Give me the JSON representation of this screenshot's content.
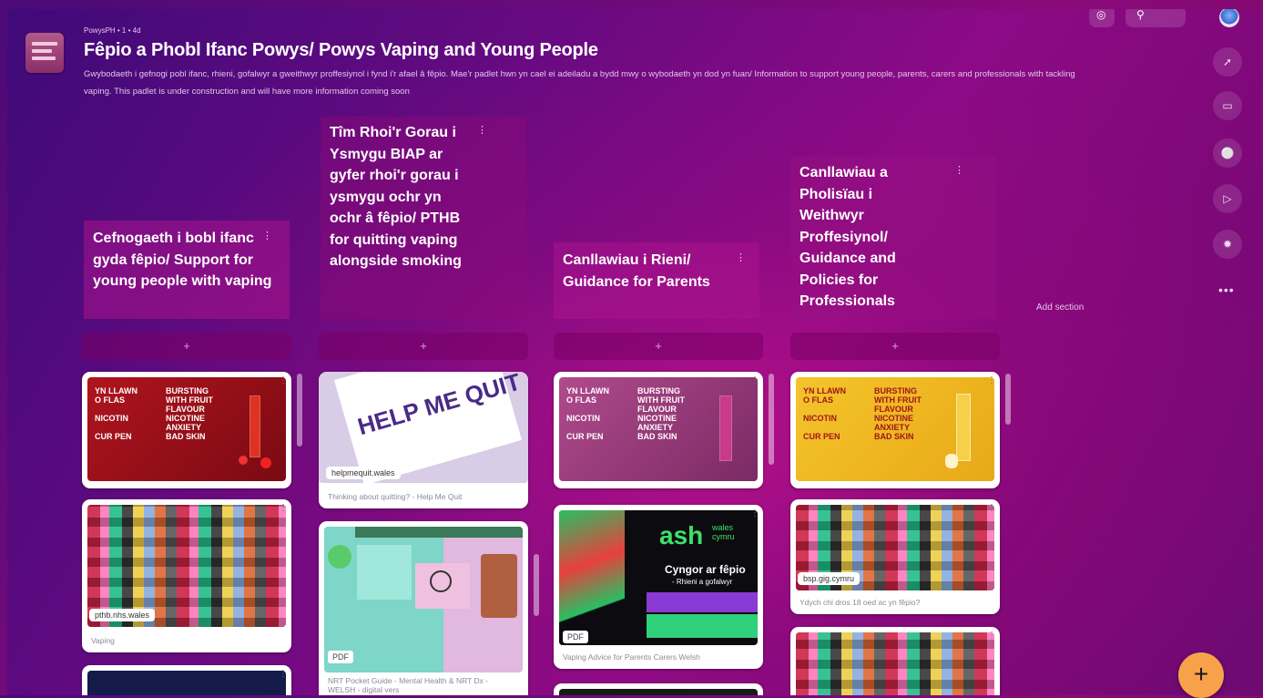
{
  "header": {
    "meta": "PowysPH • 1 • 4d",
    "title": "Fêpio a Phobl Ifanc Powys/ Powys Vaping and Young People",
    "description": "Gwybodaeth i gefnogi pobl ifanc, rhieni, gofalwyr a gweithwyr proffesiynol i fynd i'r afael â fêpio. Mae'r padlet hwn yn cael ei adeiladu a bydd mwy o wybodaeth yn dod yn fuan/ Information to support young people, parents, carers and professionals with tackling vaping. This padlet is under construction and will have more information coming soon"
  },
  "toolbar": {
    "globe_icon": "globe-icon",
    "search_icon": "search-icon"
  },
  "sidebar": {
    "icons": [
      "share-icon",
      "slideshow-icon",
      "bell-icon",
      "play-icon",
      "settings-icon"
    ],
    "more_label": "•••"
  },
  "sections": [
    {
      "title": "Cefnogaeth i bobl ifanc gyda fêpio/ Support for young people with vaping"
    },
    {
      "title": "Tîm Rhoi'r Gorau i Ysmygu BIAP ar gyfer rhoi'r gorau i ysmygu ochr yn ochr â fêpio/ PTHB  for quitting vaping alongside smoking"
    },
    {
      "title": "Canllawiau i Rieni/ Guidance for Parents"
    },
    {
      "title": "Canllawiau a Pholisïau i Weithwyr Proffesiynol/ Guidance and Policies for Professionals"
    }
  ],
  "add_post_label": "+",
  "add_section_label": "Add section",
  "cards": {
    "c1a": {
      "poster_left": "YN LLAWN\nO FLAS\n\nNICOTIN\n\nCUR PEN",
      "poster_right": "BURSTING\nWITH FRUIT\nFLAVOUR\nNICOTINE\nANXIETY\nBAD SKIN"
    },
    "c1b": {
      "domain": "pthb.nhs.wales",
      "caption": "Vaping"
    },
    "c2a": {
      "poster": "HELP ME QUIT",
      "domain": "helpmequit.wales",
      "caption": "Thinking about quitting? - Help Me Quit"
    },
    "c2b": {
      "pdf": "PDF",
      "caption": "NRT Pocket Guide - Mental Health & NRT Dx - WELSH - digital vers"
    },
    "c3a": {
      "poster_left": "YN LLAWN\nO FLAS\n\nNICOTIN\n\nCUR PEN",
      "poster_right": "BURSTING\nWITH FRUIT\nFLAVOUR\nNICOTINE\nANXIETY\nBAD SKIN"
    },
    "c3b": {
      "brand": "ash",
      "brand_sub": "wales\ncymru",
      "headline": "Cyngor ar fêpio",
      "sub": "- Rhieni a gofalwyr",
      "pdf": "PDF",
      "caption": "Vaping Advice for Parents Carers Welsh"
    },
    "c4a": {
      "poster_left": "YN LLAWN\nO FLAS\n\nNICOTIN\n\nCUR PEN",
      "poster_right": "BURSTING\nWITH FRUIT\nFLAVOUR\nNICOTINE\nANXIETY\nBAD SKIN"
    },
    "c4b": {
      "domain": "bsp.gig.cymru",
      "caption": "Ydych chi dros 18 oed ac yn fêpio?"
    }
  },
  "fab_label": "+",
  "colors": {
    "accent": "#f7a24a",
    "section_bg": "#aa148c",
    "background": "#6a0a82"
  }
}
